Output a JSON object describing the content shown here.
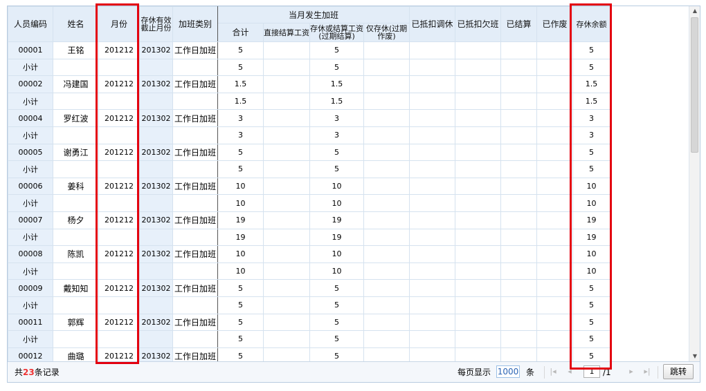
{
  "columns": {
    "person_code": "人员编码",
    "name": "姓名",
    "month": "月份",
    "cutoff_month": "存休有效截止月份",
    "ot_type": "加班类别",
    "current_group": "当月发生加班",
    "total": "合计",
    "direct_salary": "直接结算工资",
    "comp_or_salary": "存休或结算工资(过期结算)",
    "comp_only": "仅存休(过期作废)",
    "deducted_comp": "已抵扣调休",
    "deducted_absent": "已抵扣欠班",
    "settled": "已结算",
    "voided": "已作废",
    "balance": "存休余额"
  },
  "rows": [
    {
      "code": "00001",
      "name": "王铭",
      "month": "201212",
      "cutoff": "201302",
      "type": "工作日加班",
      "total": "5",
      "direct": "",
      "comp": "5",
      "comp_only": "",
      "ded_comp": "",
      "ded_abs": "",
      "settled": "",
      "voided": "",
      "balance": "5"
    },
    {
      "code": "小计",
      "name": "",
      "month": "",
      "cutoff": "",
      "type": "",
      "total": "5",
      "direct": "",
      "comp": "5",
      "comp_only": "",
      "ded_comp": "",
      "ded_abs": "",
      "settled": "",
      "voided": "",
      "balance": "5"
    },
    {
      "code": "00002",
      "name": "冯建国",
      "month": "201212",
      "cutoff": "201302",
      "type": "工作日加班",
      "total": "1.5",
      "direct": "",
      "comp": "1.5",
      "comp_only": "",
      "ded_comp": "",
      "ded_abs": "",
      "settled": "",
      "voided": "",
      "balance": "1.5"
    },
    {
      "code": "小计",
      "name": "",
      "month": "",
      "cutoff": "",
      "type": "",
      "total": "1.5",
      "direct": "",
      "comp": "1.5",
      "comp_only": "",
      "ded_comp": "",
      "ded_abs": "",
      "settled": "",
      "voided": "",
      "balance": "1.5"
    },
    {
      "code": "00004",
      "name": "罗红波",
      "month": "201212",
      "cutoff": "201302",
      "type": "工作日加班",
      "total": "3",
      "direct": "",
      "comp": "3",
      "comp_only": "",
      "ded_comp": "",
      "ded_abs": "",
      "settled": "",
      "voided": "",
      "balance": "3"
    },
    {
      "code": "小计",
      "name": "",
      "month": "",
      "cutoff": "",
      "type": "",
      "total": "3",
      "direct": "",
      "comp": "3",
      "comp_only": "",
      "ded_comp": "",
      "ded_abs": "",
      "settled": "",
      "voided": "",
      "balance": "3"
    },
    {
      "code": "00005",
      "name": "谢勇江",
      "month": "201212",
      "cutoff": "201302",
      "type": "工作日加班",
      "total": "5",
      "direct": "",
      "comp": "5",
      "comp_only": "",
      "ded_comp": "",
      "ded_abs": "",
      "settled": "",
      "voided": "",
      "balance": "5"
    },
    {
      "code": "小计",
      "name": "",
      "month": "",
      "cutoff": "",
      "type": "",
      "total": "5",
      "direct": "",
      "comp": "5",
      "comp_only": "",
      "ded_comp": "",
      "ded_abs": "",
      "settled": "",
      "voided": "",
      "balance": "5"
    },
    {
      "code": "00006",
      "name": "姜科",
      "month": "201212",
      "cutoff": "201302",
      "type": "工作日加班",
      "total": "10",
      "direct": "",
      "comp": "10",
      "comp_only": "",
      "ded_comp": "",
      "ded_abs": "",
      "settled": "",
      "voided": "",
      "balance": "10"
    },
    {
      "code": "小计",
      "name": "",
      "month": "",
      "cutoff": "",
      "type": "",
      "total": "10",
      "direct": "",
      "comp": "10",
      "comp_only": "",
      "ded_comp": "",
      "ded_abs": "",
      "settled": "",
      "voided": "",
      "balance": "10"
    },
    {
      "code": "00007",
      "name": "杨夕",
      "month": "201212",
      "cutoff": "201302",
      "type": "工作日加班",
      "total": "19",
      "direct": "",
      "comp": "19",
      "comp_only": "",
      "ded_comp": "",
      "ded_abs": "",
      "settled": "",
      "voided": "",
      "balance": "19"
    },
    {
      "code": "小计",
      "name": "",
      "month": "",
      "cutoff": "",
      "type": "",
      "total": "19",
      "direct": "",
      "comp": "19",
      "comp_only": "",
      "ded_comp": "",
      "ded_abs": "",
      "settled": "",
      "voided": "",
      "balance": "19"
    },
    {
      "code": "00008",
      "name": "陈凯",
      "month": "201212",
      "cutoff": "201302",
      "type": "工作日加班",
      "total": "10",
      "direct": "",
      "comp": "10",
      "comp_only": "",
      "ded_comp": "",
      "ded_abs": "",
      "settled": "",
      "voided": "",
      "balance": "10"
    },
    {
      "code": "小计",
      "name": "",
      "month": "",
      "cutoff": "",
      "type": "",
      "total": "10",
      "direct": "",
      "comp": "10",
      "comp_only": "",
      "ded_comp": "",
      "ded_abs": "",
      "settled": "",
      "voided": "",
      "balance": "10"
    },
    {
      "code": "00009",
      "name": "戴知知",
      "month": "201212",
      "cutoff": "201302",
      "type": "工作日加班",
      "total": "5",
      "direct": "",
      "comp": "5",
      "comp_only": "",
      "ded_comp": "",
      "ded_abs": "",
      "settled": "",
      "voided": "",
      "balance": "5"
    },
    {
      "code": "小计",
      "name": "",
      "month": "",
      "cutoff": "",
      "type": "",
      "total": "5",
      "direct": "",
      "comp": "5",
      "comp_only": "",
      "ded_comp": "",
      "ded_abs": "",
      "settled": "",
      "voided": "",
      "balance": "5"
    },
    {
      "code": "00011",
      "name": "郭辉",
      "month": "201212",
      "cutoff": "201302",
      "type": "工作日加班",
      "total": "5",
      "direct": "",
      "comp": "5",
      "comp_only": "",
      "ded_comp": "",
      "ded_abs": "",
      "settled": "",
      "voided": "",
      "balance": "5"
    },
    {
      "code": "小计",
      "name": "",
      "month": "",
      "cutoff": "",
      "type": "",
      "total": "5",
      "direct": "",
      "comp": "5",
      "comp_only": "",
      "ded_comp": "",
      "ded_abs": "",
      "settled": "",
      "voided": "",
      "balance": "5"
    },
    {
      "code": "00012",
      "name": "曲璐",
      "month": "201212",
      "cutoff": "201302",
      "type": "工作日加班",
      "total": "5",
      "direct": "",
      "comp": "5",
      "comp_only": "",
      "ded_comp": "",
      "ded_abs": "",
      "settled": "",
      "voided": "",
      "balance": "5"
    }
  ],
  "footer": {
    "total_prefix": "共",
    "total_count": "23",
    "total_suffix": "条记录",
    "page_size_label": "每页显示",
    "page_size": "1000",
    "page_size_unit": "条",
    "current_page": "1",
    "page_total": "/1",
    "jump_label": "跳转"
  },
  "icons": {
    "first": "first-page-icon",
    "prev": "prev-page-icon",
    "next": "next-page-icon",
    "last": "last-page-icon"
  },
  "highlight_color": "#e3000f"
}
